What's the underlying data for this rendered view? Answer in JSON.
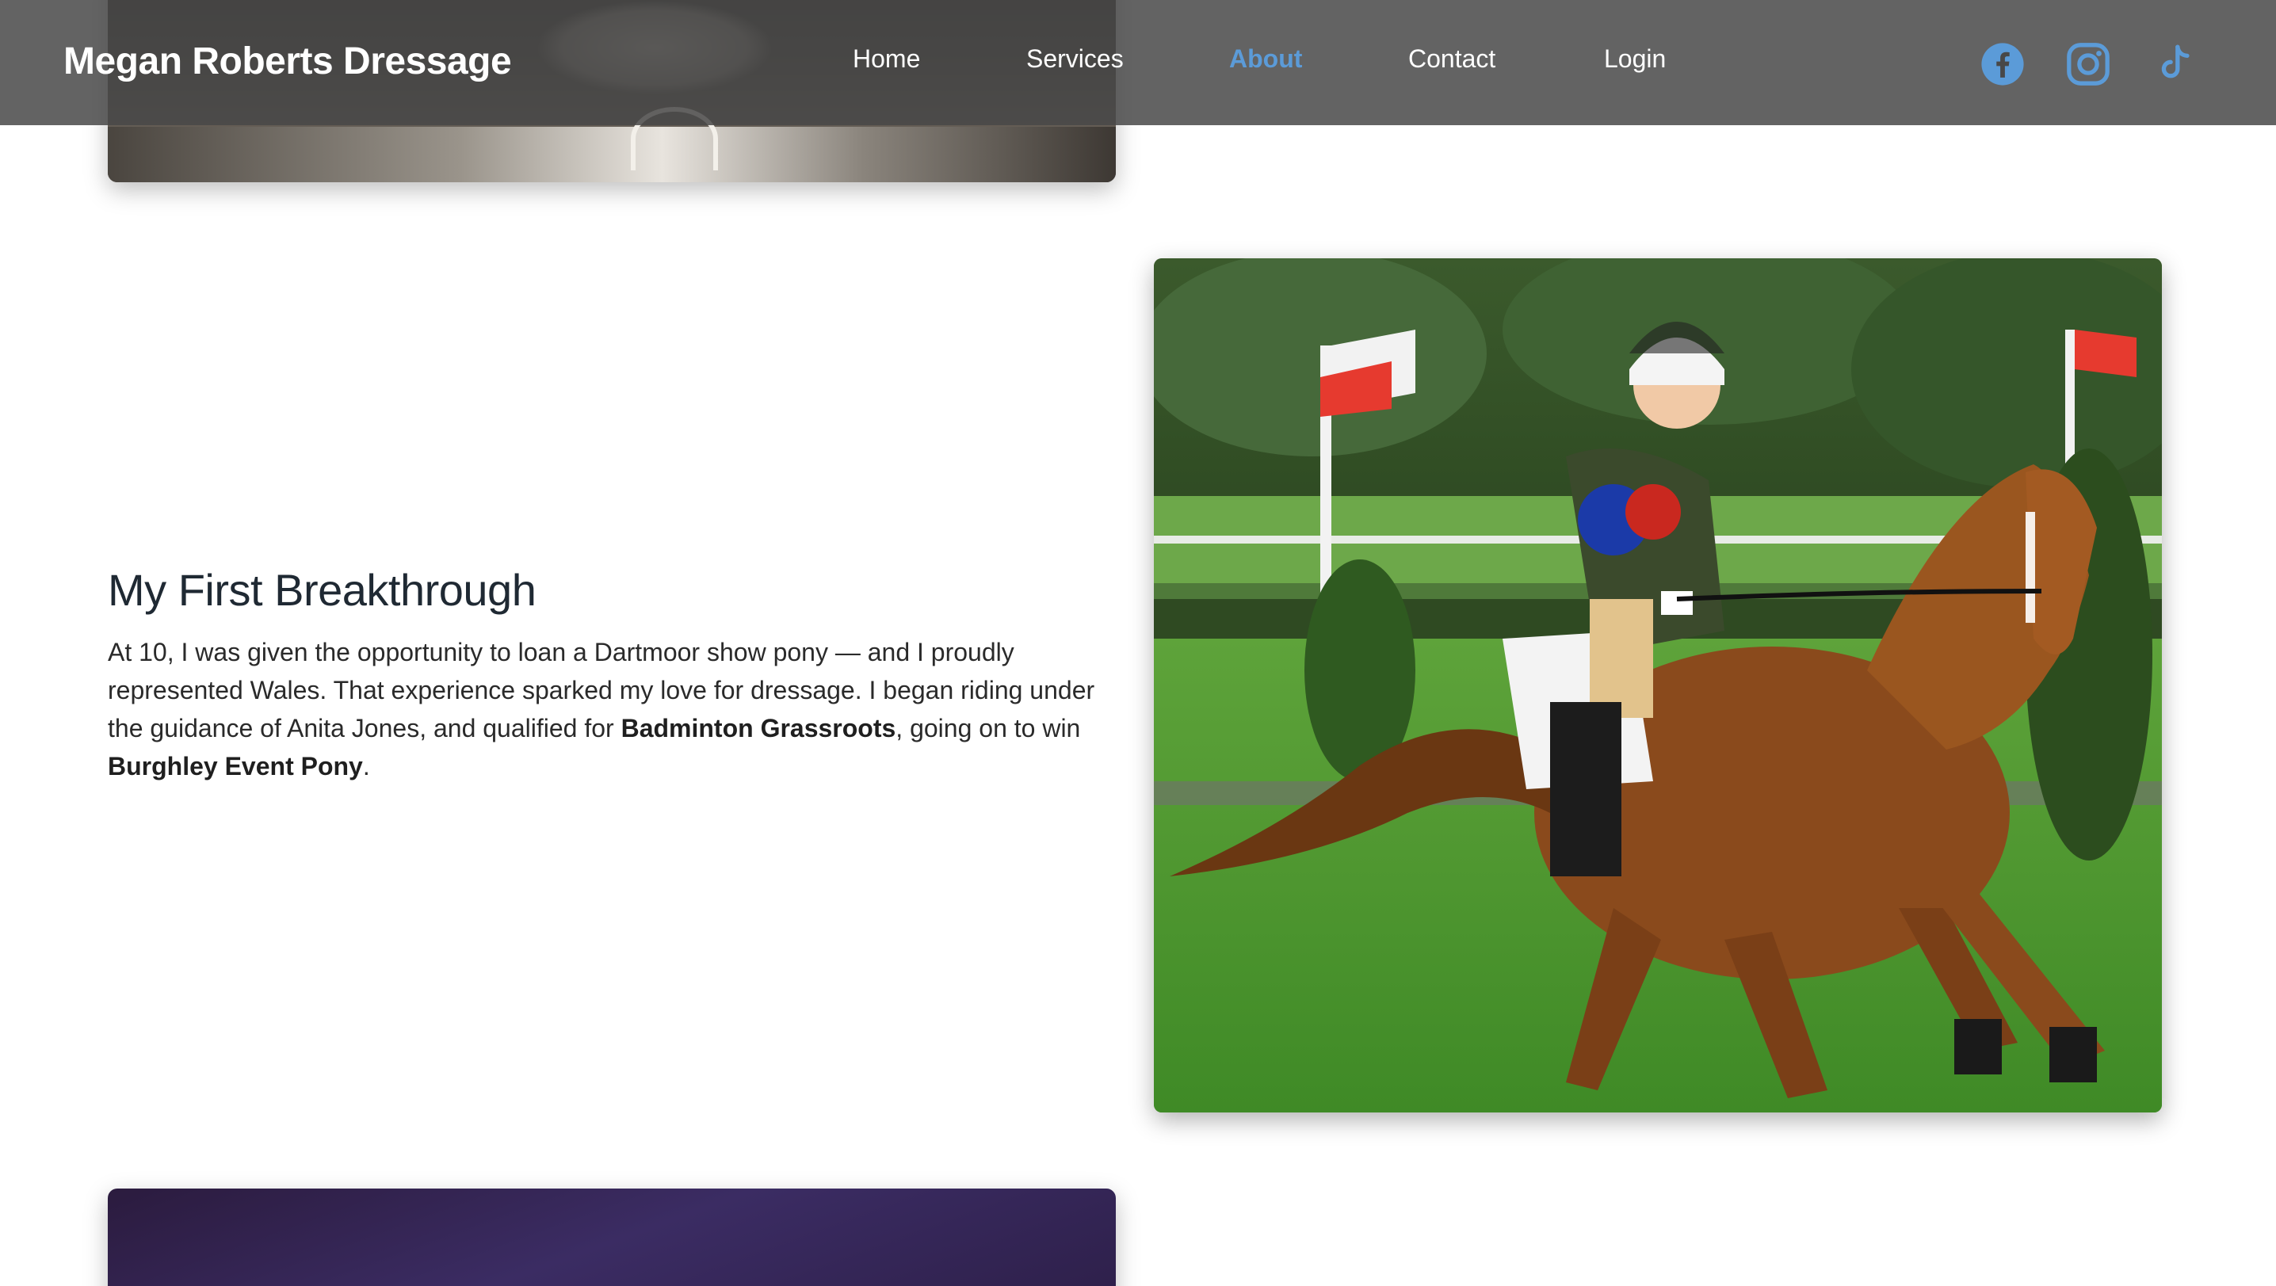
{
  "brand": {
    "name": "Megan Roberts Dressage"
  },
  "nav": {
    "items": [
      {
        "label": "Home",
        "active": false
      },
      {
        "label": "Services",
        "active": false
      },
      {
        "label": "About",
        "active": true
      },
      {
        "label": "Contact",
        "active": false
      },
      {
        "label": "Login",
        "active": false
      }
    ]
  },
  "social": [
    {
      "icon": "facebook-icon",
      "color": "#5b9bd8"
    },
    {
      "icon": "instagram-icon",
      "color": "#5b9bd8"
    },
    {
      "icon": "tiktok-icon",
      "color": "#5b9bd8"
    }
  ],
  "section": {
    "title": "My First Breakthrough",
    "body_part1": "At 10, I was given the opportunity to loan a Dartmoor show pony — and I proudly represented Wales. That experience sparked my love for dressage. I began riding under the guidance of Anita Jones, and qualified for ",
    "bold1": "Badminton Grassroots",
    "body_part2": ", going on to win ",
    "bold2": "Burghley Event Pony",
    "body_part3": "."
  },
  "colors": {
    "header_bg": "#484848",
    "accent": "#5b9bd8",
    "text": "#2a2a2a"
  }
}
